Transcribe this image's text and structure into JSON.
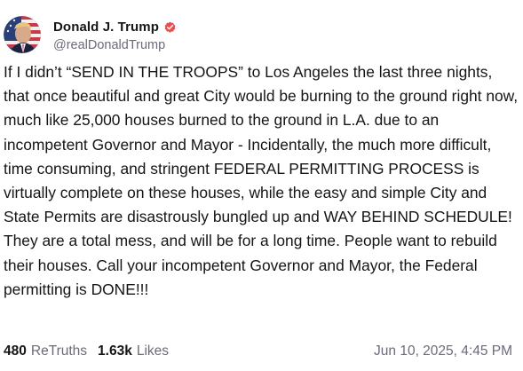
{
  "post": {
    "author": {
      "display_name": "Donald J. Trump",
      "handle": "@realDonaldTrump",
      "verified_icon": "verified-badge-icon",
      "verified_color": "#e8504f"
    },
    "text": "If I didn’t “SEND IN THE TROOPS” to Los Angeles the last three nights, that once beautiful and great City would be burning to the ground right now, much like 25,000 houses burned to the ground in L.A. due to an incompetent Governor and Mayor - Incidentally, the much more difficult, time consuming, and stringent FEDERAL PERMITTING PROCESS is virtually complete on these houses, while the easy and simple City and State Permits are disastrously bungled up and WAY BEHIND SCHEDULE! They are a total mess, and will be for a long time. People want to rebuild their houses. Call your incompetent Governor and Mayor, the Federal permitting is DONE!!!",
    "stats": {
      "retruths_count": "480",
      "retruths_label": "ReTruths",
      "likes_count": "1.63k",
      "likes_label": "Likes"
    },
    "timestamp": "Jun 10, 2025, 4:45 PM"
  }
}
